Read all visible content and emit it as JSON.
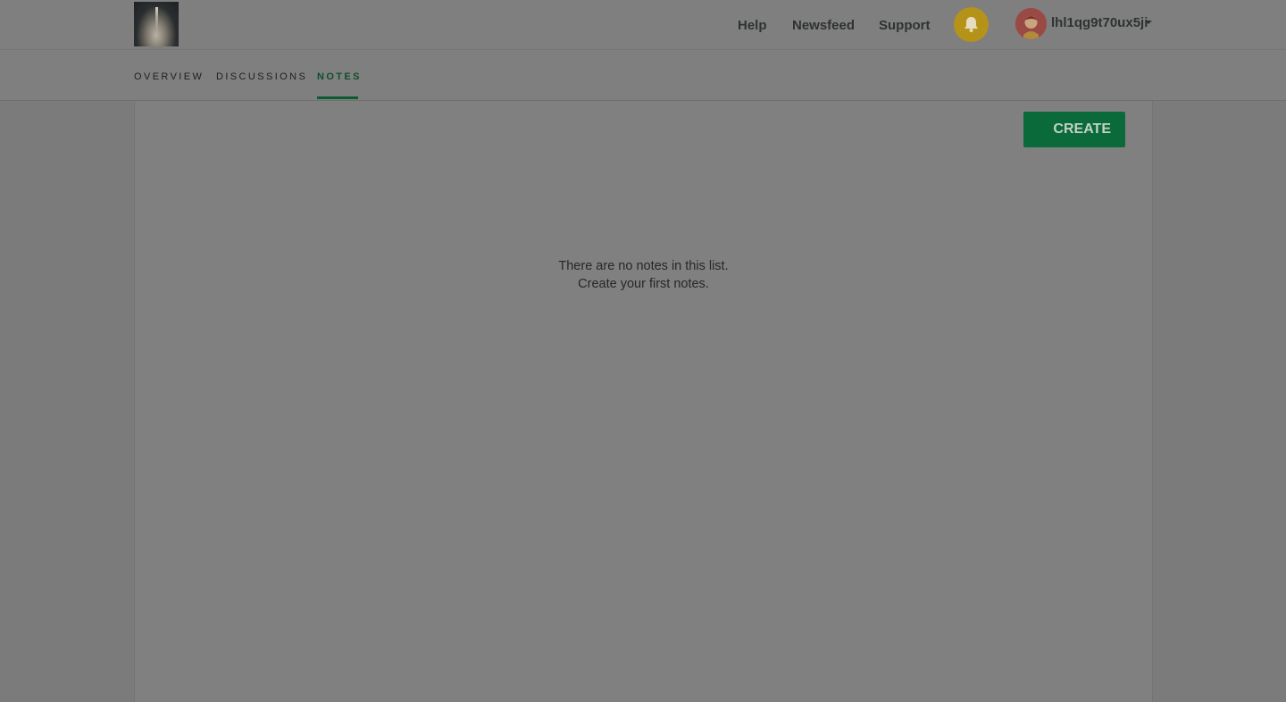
{
  "header": {
    "nav": [
      {
        "label": "Help"
      },
      {
        "label": "Newsfeed"
      },
      {
        "label": "Support"
      }
    ],
    "user": {
      "name": "lhl1qg9t70ux5ji"
    }
  },
  "tabs": [
    {
      "label": "OVERVIEW",
      "active": false
    },
    {
      "label": "DISCUSSIONS",
      "active": false
    },
    {
      "label": "NOTES",
      "active": true
    }
  ],
  "main": {
    "create_label": "CREATE",
    "empty_line1": "There are no notes in this list.",
    "empty_line2": "Create your first notes."
  },
  "icons": {
    "logo": "rocket-launch-image",
    "bell": "bell-icon",
    "avatar": "user-avatar",
    "caret": "caret-down-icon"
  },
  "colors": {
    "accent": "#0a6a39",
    "bell": "#b59318"
  }
}
